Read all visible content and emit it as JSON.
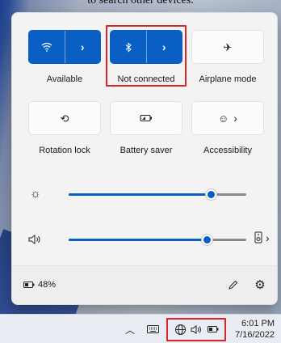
{
  "background_text": "to search other devices.",
  "tiles": [
    {
      "label": "Available",
      "left_icon": "wifi-icon",
      "right_icon": "chevron-right-icon",
      "state": "on"
    },
    {
      "label": "Not connected",
      "left_icon": "bluetooth-icon",
      "right_icon": "chevron-right-icon",
      "state": "on"
    },
    {
      "label": "Airplane mode",
      "icon": "airplane-icon",
      "state": "off"
    },
    {
      "label": "Rotation lock",
      "icon": "rotation-lock-icon",
      "state": "off"
    },
    {
      "label": "Battery saver",
      "icon": "battery-saver-icon",
      "state": "off"
    },
    {
      "label": "Accessibility",
      "icon": "accessibility-icon",
      "chevron": "chevron-right-icon",
      "state": "off"
    }
  ],
  "sliders": {
    "brightness": {
      "icon": "brightness-icon",
      "value_percent": 80
    },
    "volume": {
      "icon": "volume-icon",
      "value_percent": 78,
      "trailing_icon": "audio-output-icon"
    }
  },
  "footer": {
    "battery_text": "48%",
    "battery_icon": "battery-icon",
    "edit_icon": "pencil-icon",
    "settings_icon": "gear-icon"
  },
  "taskbar": {
    "time": "6:01 PM",
    "date": "7/16/2022",
    "icons": [
      "chevron-up-icon",
      "keyboard-icon",
      "network-globe-icon",
      "volume-icon",
      "battery-icon"
    ]
  },
  "colors": {
    "accent": "#0a5fc4",
    "highlight": "#d8252a",
    "panel": "#f3f3f3"
  }
}
